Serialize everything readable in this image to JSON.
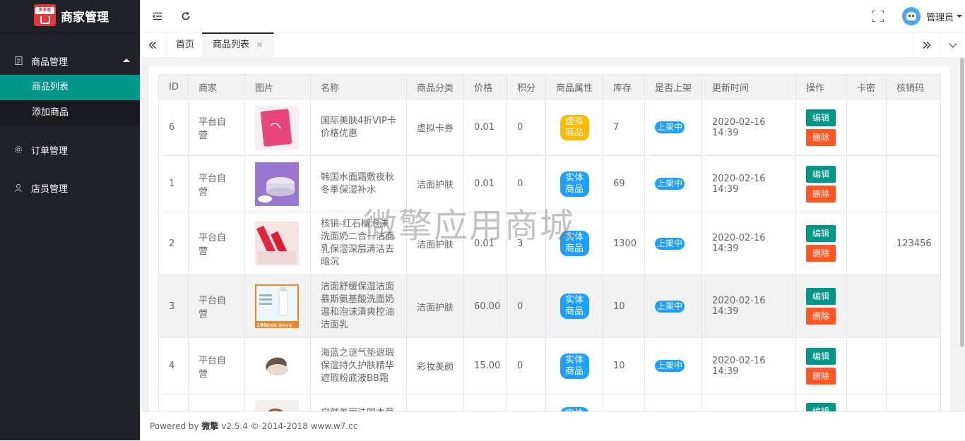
{
  "sidebar": {
    "title": "商家管理",
    "logo_text": "多多客",
    "menu": [
      {
        "label": "商品管理",
        "icon": "document-icon",
        "expanded": true,
        "children": [
          {
            "label": "商品列表",
            "active": true
          },
          {
            "label": "添加商品",
            "active": false
          }
        ]
      },
      {
        "label": "订单管理",
        "icon": "gear-icon"
      },
      {
        "label": "店员管理",
        "icon": "user-icon"
      }
    ]
  },
  "header": {
    "admin_name": "管理员"
  },
  "tabs": [
    {
      "label": "首页",
      "active": false
    },
    {
      "label": "商品列表",
      "active": true
    }
  ],
  "table": {
    "columns": [
      "ID",
      "商家",
      "图片",
      "名称",
      "商品分类",
      "价格",
      "积分",
      "商品属性",
      "库存",
      "是否上架",
      "更新时间",
      "操作",
      "卡密",
      "核销码"
    ],
    "edit_label": "编辑",
    "delete_label": "删除",
    "rows": [
      {
        "id": "6",
        "merchant": "平台自营",
        "image": "pink-vip-card",
        "name": "国际美肤4折VIP卡价格优惠",
        "category": "虚拟卡券",
        "price": "0.01",
        "points": "0",
        "attr": "虚拟商品",
        "attr_type": "virtual",
        "stock": "7",
        "status": "上架中",
        "updated": "2020-02-16 14:39",
        "card": "",
        "code": ""
      },
      {
        "id": "1",
        "merchant": "平台自营",
        "image": "purple-cream-jar",
        "name": "韩国水面霜敷夜秋冬季保湿补水",
        "category": "洁面护肤",
        "price": "0.01",
        "points": "0",
        "attr": "实体商品",
        "attr_type": "physical",
        "stock": "69",
        "status": "上架中",
        "updated": "2020-02-16 14:39",
        "card": "",
        "code": ""
      },
      {
        "id": "2",
        "merchant": "平台自营",
        "image": "red-cleanser-tubes",
        "name": "核销-红石榴泡沫洗面奶二合一洁面乳保湿深层清洁去暗沉",
        "category": "洁面护肤",
        "price": "0.01",
        "points": "3",
        "attr": "实体商品",
        "attr_type": "physical",
        "stock": "1300",
        "status": "上架中",
        "updated": "2020-02-16 14:39",
        "card": "",
        "code": "123456"
      },
      {
        "id": "3",
        "merchant": "平台自营",
        "image": "foam-cleanser-ad",
        "name": "洁面舒缓保湿洁面慕斯氨基酸洗面奶温和泡沫清爽控油洁面乳",
        "category": "洁面护肤",
        "price": "60.00",
        "points": "0",
        "attr": "实体商品",
        "attr_type": "physical",
        "stock": "10",
        "status": "上架中",
        "updated": "2020-02-16 14:39",
        "card": "",
        "code": "",
        "hover": true
      },
      {
        "id": "4",
        "merchant": "平台自营",
        "image": "cushion-compact",
        "name": "海蓝之谜气垫遮瑕保湿持久护肤精华遮瑕粉底液BB霜",
        "category": "彩妆美颜",
        "price": "15.00",
        "points": "0",
        "attr": "实体商品",
        "attr_type": "physical",
        "stock": "10",
        "status": "上架中",
        "updated": "2020-02-16 14:39",
        "card": "",
        "code": ""
      },
      {
        "id": "",
        "merchant": "",
        "image": "model-portrait",
        "name": "自然美丽法国本草",
        "category": "",
        "price": "",
        "points": "",
        "attr": "实体商品",
        "attr_type": "physical",
        "stock": "",
        "status": "",
        "updated": "",
        "card": "",
        "code": ""
      }
    ],
    "product_image_texts": {
      "foam-cleanser-ad": [
        "198",
        "氨基酸 温和洁面"
      ]
    }
  },
  "watermark": "微擎应用商城",
  "footer": {
    "prefix": "Powered by ",
    "brand": "微擎",
    "suffix": " v2.5.4 © 2014-2018 www.w7.cc"
  }
}
